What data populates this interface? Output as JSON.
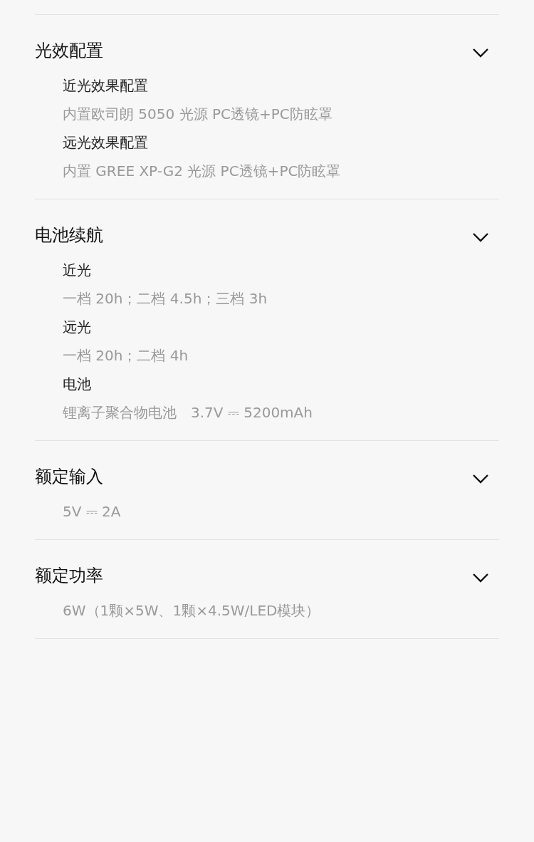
{
  "sections": [
    {
      "title": "光效配置",
      "expanded": true,
      "items": [
        {
          "label": "近光效果配置",
          "value": "内置欧司朗 5050 光源 PC透镜+PC防眩罩"
        },
        {
          "label": "远光效果配置",
          "value": "内置 GREE XP-G2 光源 PC透镜+PC防眩罩"
        }
      ]
    },
    {
      "title": "电池续航",
      "expanded": true,
      "items": [
        {
          "label": "近光",
          "value": "一档 20h；二档 4.5h；三档 3h"
        },
        {
          "label": "远光",
          "value": "一档 20h；二档 4h"
        },
        {
          "label": "电池",
          "value": "锂离子聚合物电池　3.7V ⎓ 5200mAh"
        }
      ]
    },
    {
      "title": "额定输入",
      "expanded": true,
      "items": [
        {
          "value": "5V ⎓ 2A"
        }
      ]
    },
    {
      "title": "额定功率",
      "expanded": true,
      "items": [
        {
          "value": "6W（1颗×5W、1颗×4.5W/LED模块）"
        }
      ]
    }
  ]
}
